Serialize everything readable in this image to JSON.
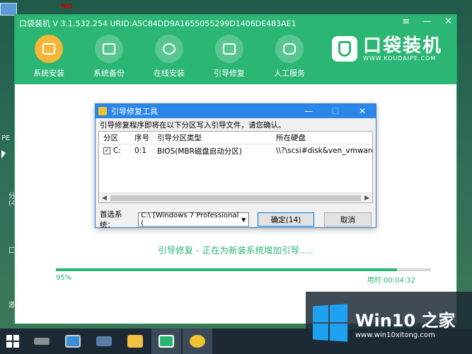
{
  "desktop": {
    "left_texts": [
      "PE",
      "分",
      "(4",
      "口",
      "激"
    ],
    "icon_badge": "NO"
  },
  "app": {
    "title": "口袋装机 V 3.1.532.254 URID:A5C84DD9A1655055299D1406DE483AE1",
    "win_controls": [
      "≡",
      "—",
      "✕"
    ],
    "nav": [
      {
        "label": "系统安装",
        "icon": "box-icon",
        "active": true
      },
      {
        "label": "系统备份",
        "icon": "backup-icon",
        "active": false
      },
      {
        "label": "在线安装",
        "icon": "download-icon",
        "active": false
      },
      {
        "label": "引导修复",
        "icon": "toolbox-icon",
        "active": false
      },
      {
        "label": "人工服务",
        "icon": "chat-icon",
        "active": false
      }
    ],
    "brand": {
      "name": "口袋装机",
      "url": "WWW.KOUDAIPE.COM"
    }
  },
  "dialog": {
    "title": "引导修复工具",
    "controls": [
      "—",
      "☐",
      "✕"
    ],
    "description": "引导修复程序即将在以下分区写入引导文件，请您确认。",
    "columns": [
      "分区",
      "序号",
      "引导分区类型",
      "所在硬盘"
    ],
    "rows": [
      {
        "checked": true,
        "partition": "C:",
        "index": "0:1",
        "type": "BIOS(MBR磁盘启动分区)",
        "disk": "\\\\?\\scsi#disk&ven_vmware_&"
      }
    ],
    "scroll_left": "◀",
    "scroll_right": "▶",
    "preferred_label": "首选系统：",
    "preferred_value": "C:\\ [Windows 7 Professional (",
    "ok_label": "确定(14)",
    "cancel_label": "取消"
  },
  "progress": {
    "status": "引导修复 - 正在为新装系统增加引导.....",
    "percent_label": "95%",
    "percent": 0.91,
    "elapsed": "用时:00:04:32"
  },
  "watermark": {
    "title": "Win10 之家",
    "url": "www.win10xitong.com"
  },
  "colors": {
    "brand_green": "#2bb673",
    "dialog_blue": "#2b86e8",
    "taskbar": "#1d2a36"
  }
}
